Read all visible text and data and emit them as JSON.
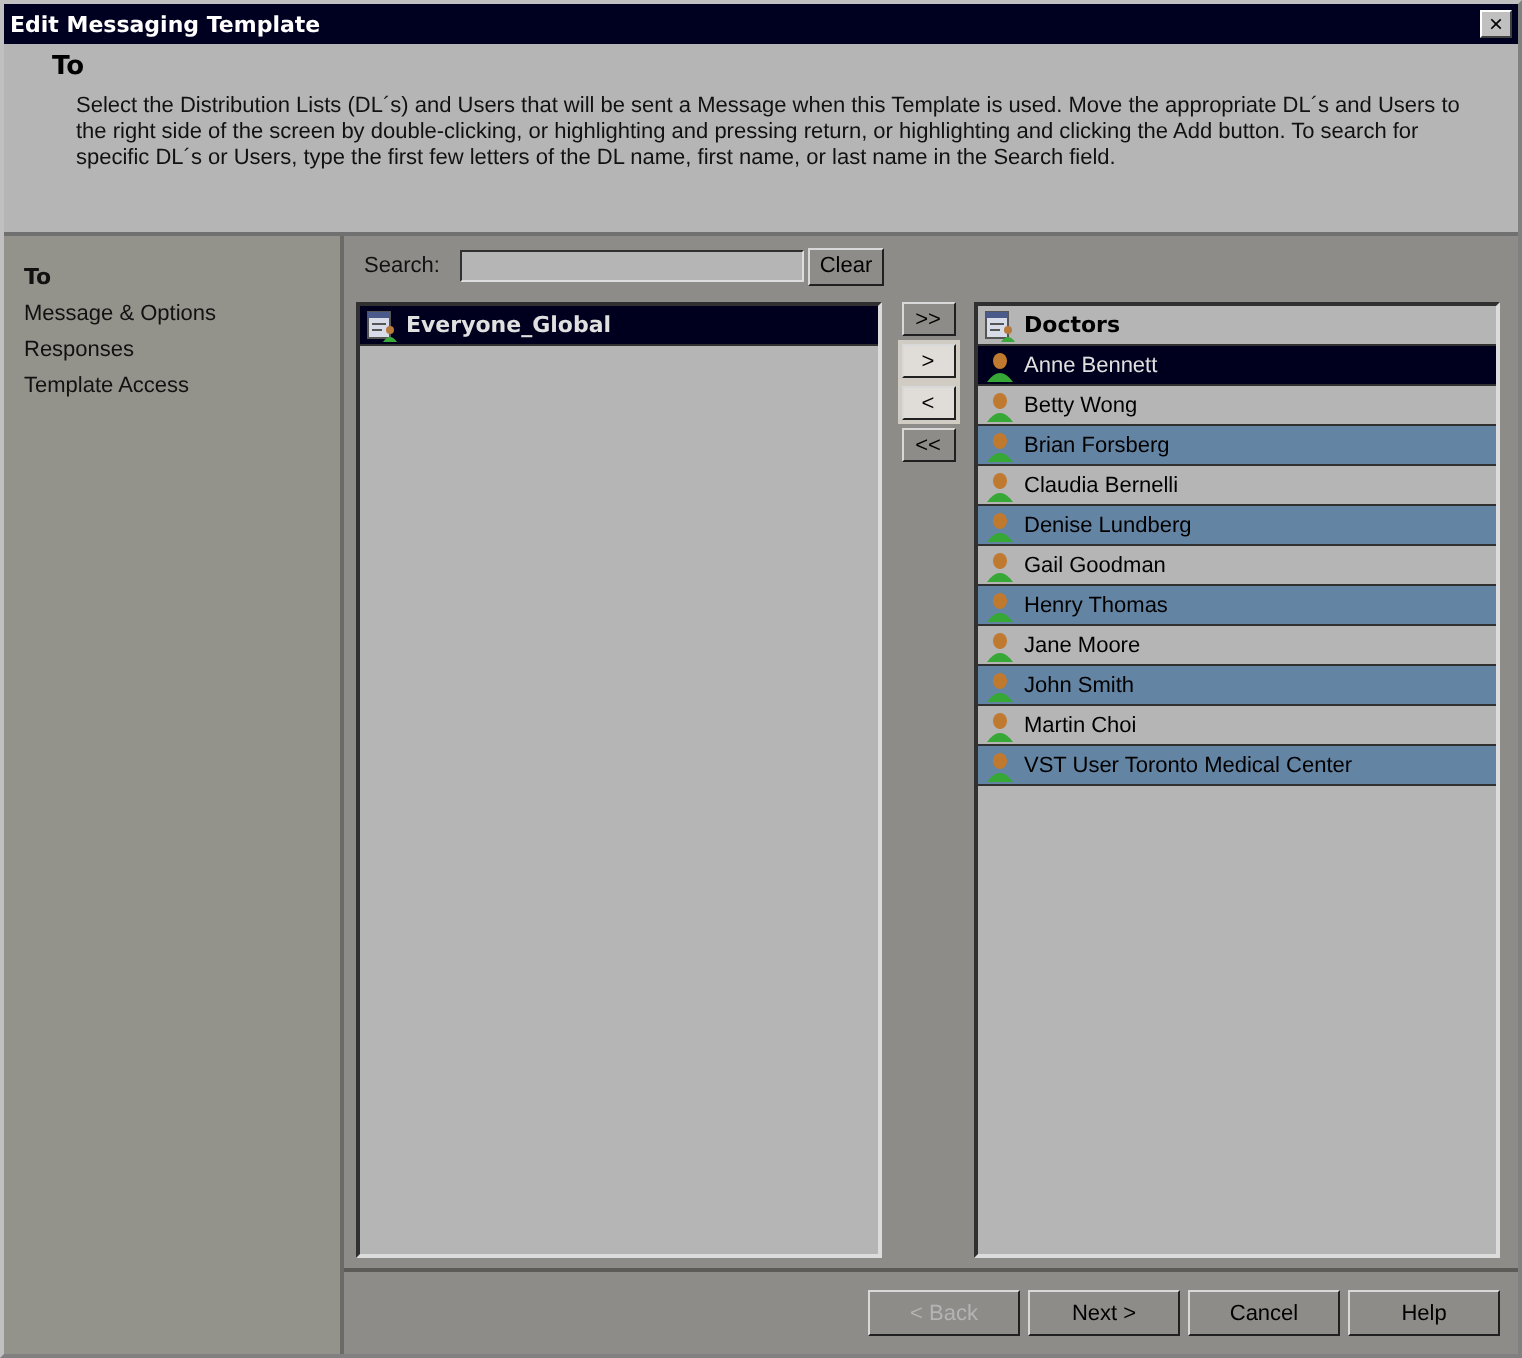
{
  "window": {
    "title": "Edit Messaging Template",
    "close": "×"
  },
  "header": {
    "title": "To",
    "description": "Select the Distribution Lists (DL´s) and Users that will be sent a Message when this Template is used.  Move the appropriate DL´s and Users to the right side of the screen by double-clicking, or highlighting and pressing return, or highlighting and clicking the Add button. To search for specific DL´s or Users, type the first few letters of the DL name, first name, or last name in the Search field."
  },
  "sidebar": {
    "items": [
      {
        "label": "To",
        "selected": true
      },
      {
        "label": "Message & Options",
        "selected": false
      },
      {
        "label": "Responses",
        "selected": false
      },
      {
        "label": "Template Access",
        "selected": false
      }
    ]
  },
  "search": {
    "label": "Search:",
    "button": "Clear"
  },
  "available": {
    "items": [
      {
        "label": "Everyone_Global",
        "kind": "group",
        "selected": true
      }
    ]
  },
  "move_buttons": [
    {
      "label": ">>",
      "highlighted": false
    },
    {
      "label": ">",
      "highlighted": true
    },
    {
      "label": "<",
      "highlighted": true
    },
    {
      "label": "<<",
      "highlighted": false
    }
  ],
  "selected_list": {
    "items": [
      {
        "label": "Doctors",
        "kind": "group",
        "selected": false
      },
      {
        "label": "Anne Bennett",
        "kind": "user",
        "selected": true
      },
      {
        "label": "Betty Wong",
        "kind": "user",
        "selected": false
      },
      {
        "label": "Brian Forsberg",
        "kind": "user",
        "selected": false
      },
      {
        "label": "Claudia Bernelli",
        "kind": "user",
        "selected": false
      },
      {
        "label": "Denise Lundberg",
        "kind": "user",
        "selected": false
      },
      {
        "label": "Gail Goodman",
        "kind": "user",
        "selected": false
      },
      {
        "label": "Henry Thomas",
        "kind": "user",
        "selected": false
      },
      {
        "label": "Jane Moore",
        "kind": "user",
        "selected": false
      },
      {
        "label": "John Smith",
        "kind": "user",
        "selected": false
      },
      {
        "label": "Martin Choi",
        "kind": "user",
        "selected": false
      },
      {
        "label": "VST User Toronto Medical Center",
        "kind": "user",
        "selected": false
      }
    ]
  },
  "footer": {
    "buttons": [
      {
        "label": "< Back",
        "disabled": true
      },
      {
        "label": "Next >",
        "disabled": false
      },
      {
        "label": "Cancel",
        "disabled": false
      },
      {
        "label": "Help",
        "disabled": false
      }
    ]
  }
}
